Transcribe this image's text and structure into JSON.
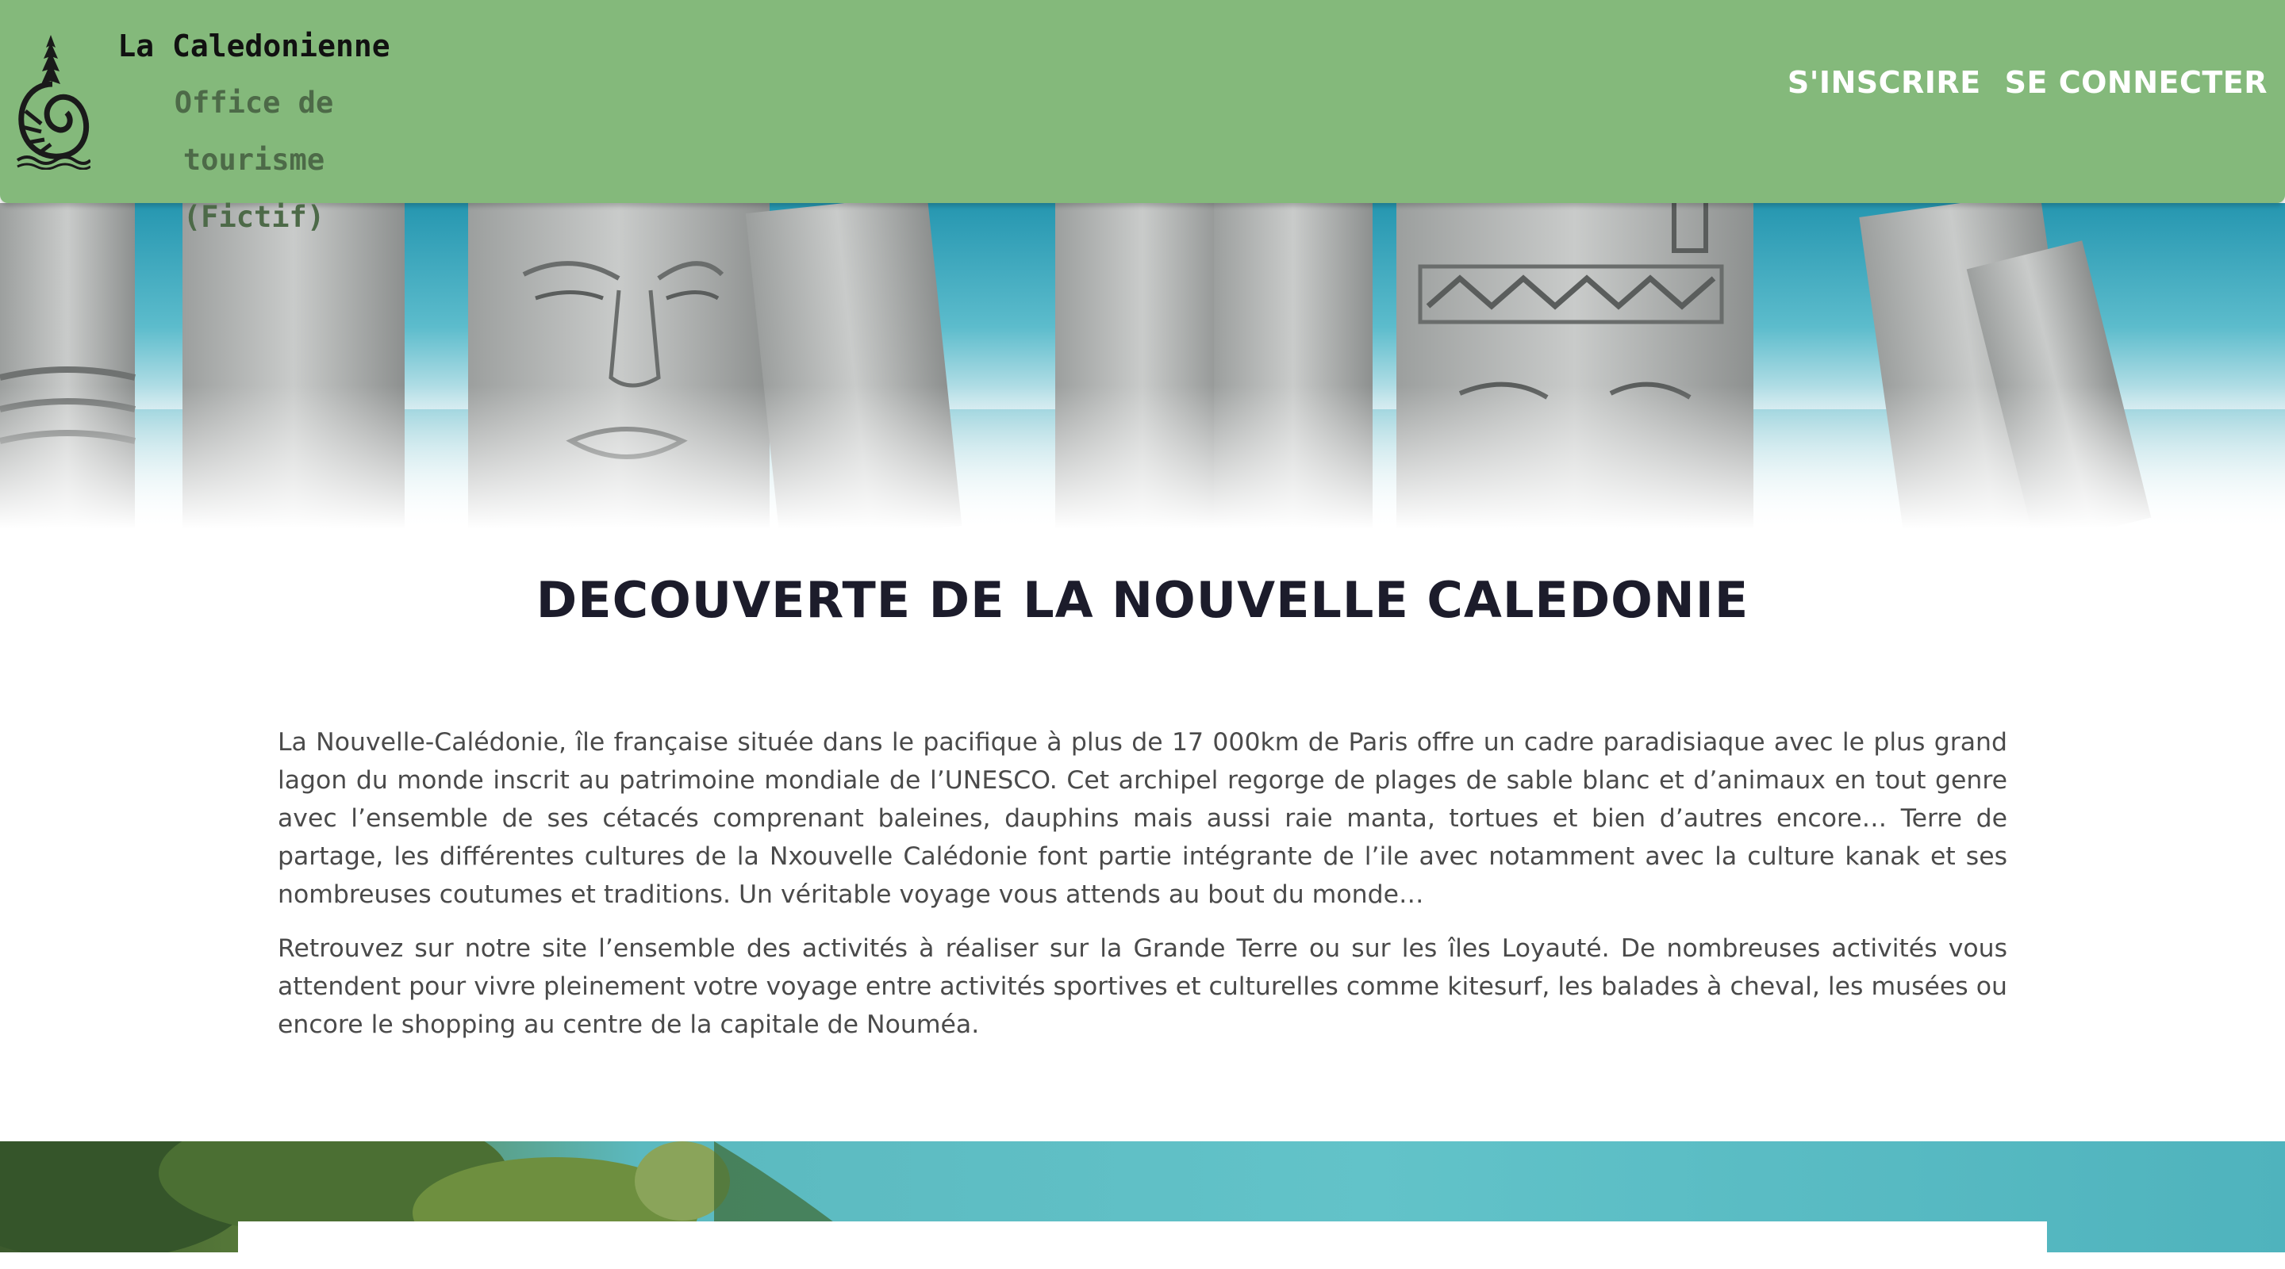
{
  "header": {
    "brand_name": "La Caledonienne",
    "brand_subtitle_line1": "Office de tourisme",
    "brand_subtitle_line2": "(Fictif)",
    "logo_icon": "nautilus-pine-logo-icon",
    "nav": [
      {
        "label": "S'INSCRIRE"
      },
      {
        "label": "SE CONNECTER"
      }
    ],
    "background_color": "#84b97b"
  },
  "hero": {
    "image": "carved-wooden-totems-lagoon-photo"
  },
  "main": {
    "title": "DECOUVERTE DE LA NOUVELLE CALEDONIE",
    "paragraphs": [
      "La Nouvelle-Calédonie, île française située dans le pacifique à plus de 17 000km de Paris offre un cadre paradisiaque avec le plus grand lagon du monde inscrit au patrimoine mondiale de l’UNESCO. Cet archipel regorge de plages de sable blanc et d’animaux en tout genre avec l’ensemble de ses cétacés comprenant baleines, dauphins mais aussi raie manta, tortues et bien d’autres encore… Terre de partage, les différentes cultures de la Nxouvelle Calédonie font partie intégrante de l’ile avec notamment avec la culture kanak et ses nombreuses coutumes et traditions. Un véritable voyage vous attends au bout du monde…",
      "Retrouvez sur notre site l’ensemble des activités à réaliser sur la Grande Terre ou sur les îles Loyauté. De nombreuses activités vous attendent pour vivre pleinement votre voyage entre activités sportives et culturelles comme kitesurf, les balades à cheval, les musées ou encore le shopping au centre de la capitale de Nouméa."
    ]
  },
  "footer_band": {
    "image": "lagoon-vegetation-photo"
  }
}
